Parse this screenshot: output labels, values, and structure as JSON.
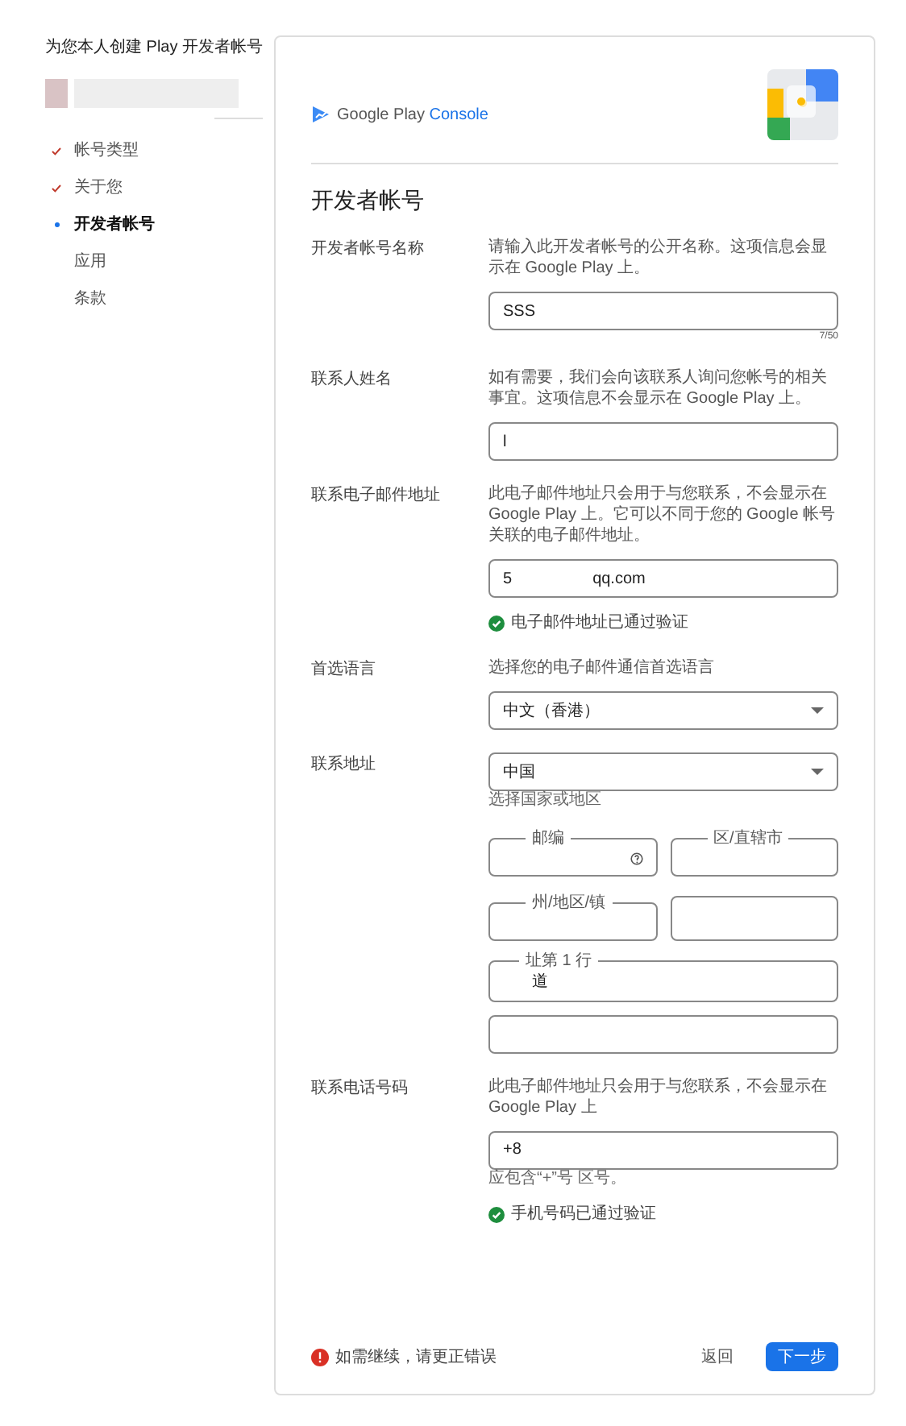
{
  "sidebar": {
    "title": "为您本人创建 Play 开发者帐号",
    "steps": [
      {
        "label": "帐号类型",
        "done": true,
        "selected": false
      },
      {
        "label": "关于您",
        "done": true,
        "selected": false
      },
      {
        "label": "开发者帐号",
        "done": false,
        "selected": true
      },
      {
        "label": "应用",
        "done": false,
        "selected": false
      },
      {
        "label": "条款",
        "done": false,
        "selected": false
      }
    ]
  },
  "header": {
    "logo_text": "Google Play",
    "logo_accent": "Console"
  },
  "page_title": "开发者帐号",
  "sections": [
    {
      "label": "开发者帐号名称",
      "description": "请输入此开发者帐号的公开名称。这项信息会显示在 Google Play 上。",
      "fields": [
        {
          "kind": "text",
          "value": "SSS",
          "counter": "7/50"
        }
      ]
    },
    {
      "label": "联系人姓名",
      "description": "如有需要，我们会向该联系人询问您帐号的相关事宜。这项信息不会显示在 Google Play 上。",
      "fields": [
        {
          "kind": "text",
          "value": "l"
        }
      ]
    },
    {
      "label": "联系电子邮件地址",
      "description": "此电子邮件地址只会用于与您联系，不会显示在 Google Play 上。它可以不同于您的 Google 帐号关联的电子邮件地址。",
      "fields": [
        {
          "kind": "text",
          "value": "5",
          "suffix": "qq.com"
        }
      ],
      "verified": "电子邮件地址已通过验证"
    },
    {
      "label": "首选语言",
      "description": "选择您的电子邮件通信首选语言",
      "fields": [
        {
          "kind": "select",
          "value": "中文（香港）"
        }
      ]
    },
    {
      "label": "联系地址",
      "fields": [
        {
          "kind": "select",
          "value": "中国",
          "hint": "选择国家或地区"
        },
        {
          "kind": "pair",
          "items": [
            {
              "label": "邮编",
              "help": true
            },
            {
              "label": "区/直辖市",
              "help": false
            }
          ]
        },
        {
          "kind": "pair",
          "items": [
            {
              "label": "州/地区/镇",
              "help": false
            },
            {
              "help": false
            }
          ]
        },
        {
          "kind": "text",
          "label": "址第 1 行",
          "value": "道"
        },
        {
          "kind": "text"
        }
      ]
    },
    {
      "label": "联系电话号码",
      "description": "此电子邮件地址只会用于与您联系，不会显示在 Google Play 上",
      "fields": [
        {
          "kind": "text",
          "value": "+8",
          "hint": "应包含“+”号 区号。"
        }
      ],
      "verified": "手机号码已通过验证"
    }
  ],
  "footer": {
    "error": "如需继续，请更正错误",
    "back": "返回",
    "next": "下一步"
  }
}
